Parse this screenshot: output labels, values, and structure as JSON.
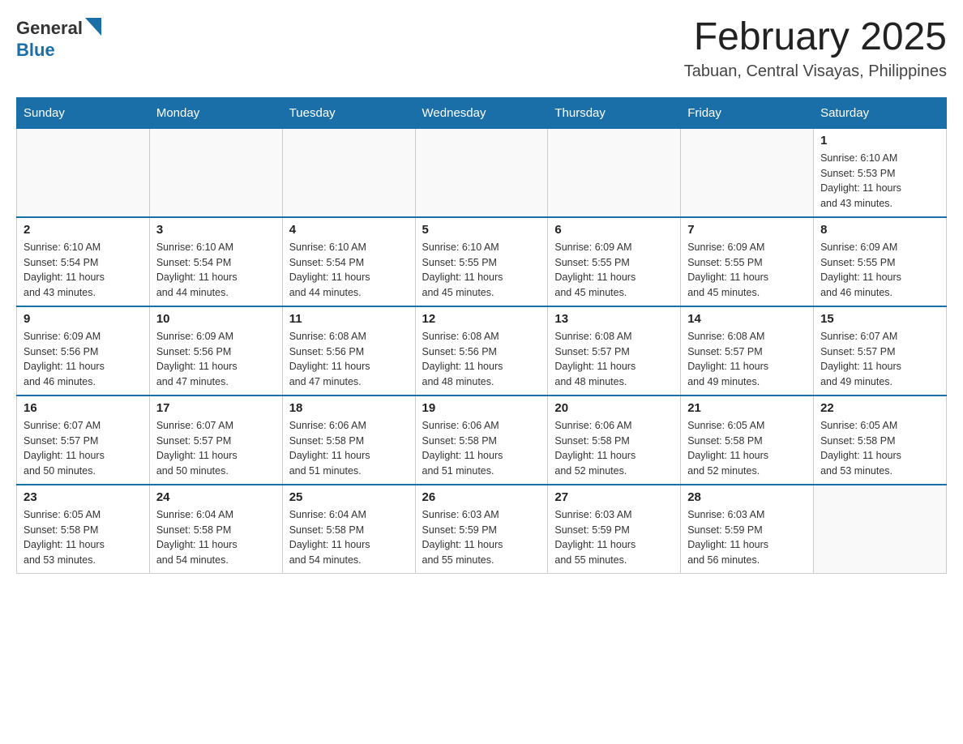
{
  "logo": {
    "general": "General",
    "blue": "Blue"
  },
  "header": {
    "title": "February 2025",
    "subtitle": "Tabuan, Central Visayas, Philippines"
  },
  "weekdays": [
    "Sunday",
    "Monday",
    "Tuesday",
    "Wednesday",
    "Thursday",
    "Friday",
    "Saturday"
  ],
  "weeks": [
    [
      {
        "day": "",
        "info": ""
      },
      {
        "day": "",
        "info": ""
      },
      {
        "day": "",
        "info": ""
      },
      {
        "day": "",
        "info": ""
      },
      {
        "day": "",
        "info": ""
      },
      {
        "day": "",
        "info": ""
      },
      {
        "day": "1",
        "info": "Sunrise: 6:10 AM\nSunset: 5:53 PM\nDaylight: 11 hours\nand 43 minutes."
      }
    ],
    [
      {
        "day": "2",
        "info": "Sunrise: 6:10 AM\nSunset: 5:54 PM\nDaylight: 11 hours\nand 43 minutes."
      },
      {
        "day": "3",
        "info": "Sunrise: 6:10 AM\nSunset: 5:54 PM\nDaylight: 11 hours\nand 44 minutes."
      },
      {
        "day": "4",
        "info": "Sunrise: 6:10 AM\nSunset: 5:54 PM\nDaylight: 11 hours\nand 44 minutes."
      },
      {
        "day": "5",
        "info": "Sunrise: 6:10 AM\nSunset: 5:55 PM\nDaylight: 11 hours\nand 45 minutes."
      },
      {
        "day": "6",
        "info": "Sunrise: 6:09 AM\nSunset: 5:55 PM\nDaylight: 11 hours\nand 45 minutes."
      },
      {
        "day": "7",
        "info": "Sunrise: 6:09 AM\nSunset: 5:55 PM\nDaylight: 11 hours\nand 45 minutes."
      },
      {
        "day": "8",
        "info": "Sunrise: 6:09 AM\nSunset: 5:55 PM\nDaylight: 11 hours\nand 46 minutes."
      }
    ],
    [
      {
        "day": "9",
        "info": "Sunrise: 6:09 AM\nSunset: 5:56 PM\nDaylight: 11 hours\nand 46 minutes."
      },
      {
        "day": "10",
        "info": "Sunrise: 6:09 AM\nSunset: 5:56 PM\nDaylight: 11 hours\nand 47 minutes."
      },
      {
        "day": "11",
        "info": "Sunrise: 6:08 AM\nSunset: 5:56 PM\nDaylight: 11 hours\nand 47 minutes."
      },
      {
        "day": "12",
        "info": "Sunrise: 6:08 AM\nSunset: 5:56 PM\nDaylight: 11 hours\nand 48 minutes."
      },
      {
        "day": "13",
        "info": "Sunrise: 6:08 AM\nSunset: 5:57 PM\nDaylight: 11 hours\nand 48 minutes."
      },
      {
        "day": "14",
        "info": "Sunrise: 6:08 AM\nSunset: 5:57 PM\nDaylight: 11 hours\nand 49 minutes."
      },
      {
        "day": "15",
        "info": "Sunrise: 6:07 AM\nSunset: 5:57 PM\nDaylight: 11 hours\nand 49 minutes."
      }
    ],
    [
      {
        "day": "16",
        "info": "Sunrise: 6:07 AM\nSunset: 5:57 PM\nDaylight: 11 hours\nand 50 minutes."
      },
      {
        "day": "17",
        "info": "Sunrise: 6:07 AM\nSunset: 5:57 PM\nDaylight: 11 hours\nand 50 minutes."
      },
      {
        "day": "18",
        "info": "Sunrise: 6:06 AM\nSunset: 5:58 PM\nDaylight: 11 hours\nand 51 minutes."
      },
      {
        "day": "19",
        "info": "Sunrise: 6:06 AM\nSunset: 5:58 PM\nDaylight: 11 hours\nand 51 minutes."
      },
      {
        "day": "20",
        "info": "Sunrise: 6:06 AM\nSunset: 5:58 PM\nDaylight: 11 hours\nand 52 minutes."
      },
      {
        "day": "21",
        "info": "Sunrise: 6:05 AM\nSunset: 5:58 PM\nDaylight: 11 hours\nand 52 minutes."
      },
      {
        "day": "22",
        "info": "Sunrise: 6:05 AM\nSunset: 5:58 PM\nDaylight: 11 hours\nand 53 minutes."
      }
    ],
    [
      {
        "day": "23",
        "info": "Sunrise: 6:05 AM\nSunset: 5:58 PM\nDaylight: 11 hours\nand 53 minutes."
      },
      {
        "day": "24",
        "info": "Sunrise: 6:04 AM\nSunset: 5:58 PM\nDaylight: 11 hours\nand 54 minutes."
      },
      {
        "day": "25",
        "info": "Sunrise: 6:04 AM\nSunset: 5:58 PM\nDaylight: 11 hours\nand 54 minutes."
      },
      {
        "day": "26",
        "info": "Sunrise: 6:03 AM\nSunset: 5:59 PM\nDaylight: 11 hours\nand 55 minutes."
      },
      {
        "day": "27",
        "info": "Sunrise: 6:03 AM\nSunset: 5:59 PM\nDaylight: 11 hours\nand 55 minutes."
      },
      {
        "day": "28",
        "info": "Sunrise: 6:03 AM\nSunset: 5:59 PM\nDaylight: 11 hours\nand 56 minutes."
      },
      {
        "day": "",
        "info": ""
      }
    ]
  ]
}
